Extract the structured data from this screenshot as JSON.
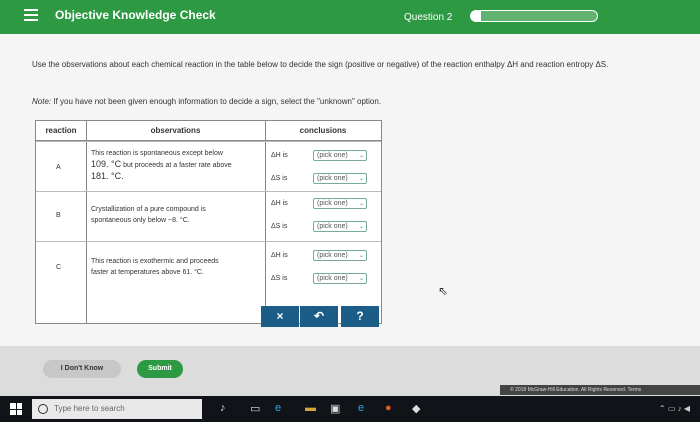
{
  "header": {
    "title": "Objective Knowledge Check",
    "question": "Question 2",
    "progress": 0.08
  },
  "instructions": {
    "line1": "Use the observations about each chemical reaction in the table below to decide the sign (positive or negative) of the reaction enthalpy ΔH and reaction entropy ΔS.",
    "note_label": "Note:",
    "note_text": "If you have not been given enough information to decide a sign, select the \"unknown\" option."
  },
  "table": {
    "headers": {
      "reaction": "reaction",
      "observations": "observations",
      "conclusions": "conclusions"
    },
    "rows": [
      {
        "letter": "A",
        "obs_line1": "This reaction is spontaneous except below",
        "obs_line2_pre": "109. °C",
        "obs_line2_post": "but proceeds at a faster rate above",
        "obs_line3": "181. °C.",
        "dh_label": "ΔH is",
        "ds_label": "ΔS is",
        "dh_pick": "(pick one)",
        "ds_pick": "(pick one)"
      },
      {
        "letter": "B",
        "obs_line1": "Crystallization of a pure compound is",
        "obs_line2": "spontaneous only below −8. °C.",
        "dh_label": "ΔH is",
        "ds_label": "ΔS is",
        "dh_pick": "(pick one)",
        "ds_pick": "(pick one)"
      },
      {
        "letter": "C",
        "obs_line1": "This reaction is exothermic and proceeds",
        "obs_line2": "faster at temperatures above 61. °C.",
        "dh_label": "ΔH is",
        "ds_label": "ΔS is",
        "dh_pick": "(pick one)",
        "ds_pick": "(pick one)"
      }
    ]
  },
  "actions": {
    "clear": "×",
    "undo": "↶",
    "help": "?"
  },
  "footer": {
    "dont_know": "I Don't Know",
    "submit": "Submit",
    "copyright": "© 2018 McGraw-Hill Education. All Rights Reserved. Terms"
  },
  "taskbar": {
    "search_placeholder": "Type here to search"
  }
}
